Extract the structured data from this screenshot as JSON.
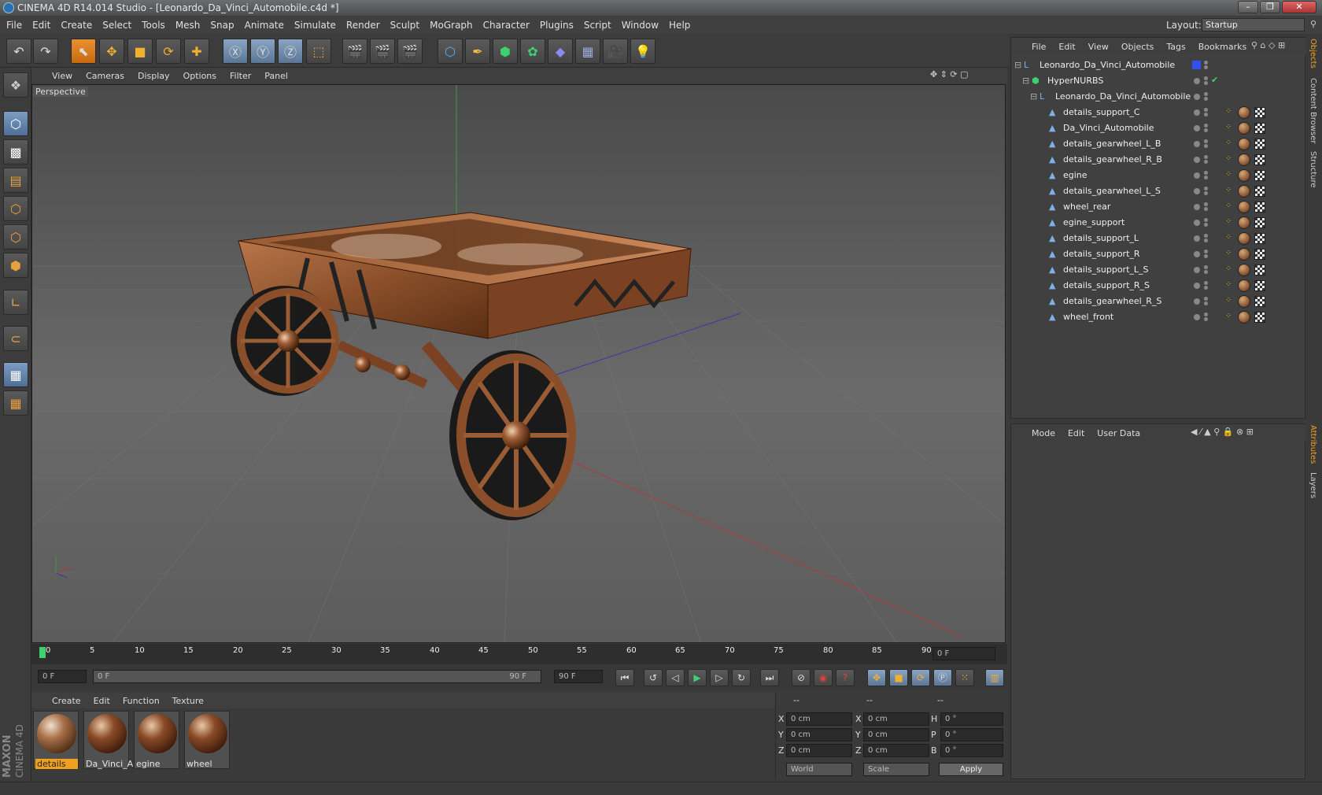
{
  "window": {
    "title": "CINEMA 4D R14.014 Studio - [Leonardo_Da_Vinci_Automobile.c4d *]"
  },
  "menu": [
    "File",
    "Edit",
    "Create",
    "Select",
    "Tools",
    "Mesh",
    "Snap",
    "Animate",
    "Simulate",
    "Render",
    "Sculpt",
    "MoGraph",
    "Character",
    "Plugins",
    "Script",
    "Window",
    "Help"
  ],
  "layout": {
    "label": "Layout:",
    "value": "Startup"
  },
  "viewport": {
    "menu": [
      "View",
      "Cameras",
      "Display",
      "Options",
      "Filter",
      "Panel"
    ],
    "label": "Perspective"
  },
  "timeline": {
    "ticks": [
      "0",
      "5",
      "10",
      "15",
      "20",
      "25",
      "30",
      "35",
      "40",
      "45",
      "50",
      "55",
      "60",
      "65",
      "70",
      "75",
      "80",
      "85",
      "90"
    ],
    "current_frame": "0 F"
  },
  "transport": {
    "start": "0 F",
    "slider_start": "0 F",
    "slider_end": "90 F",
    "end": "90 F"
  },
  "objects": {
    "menu": [
      "File",
      "Edit",
      "View",
      "Objects",
      "Tags",
      "Bookmarks"
    ],
    "root": "Leonardo_Da_Vinci_Automobile",
    "nurbs": "HyperNURBS",
    "group": "Leonardo_Da_Vinci_Automobile",
    "items": [
      "details_support_C",
      "Da_Vinci_Automobile",
      "details_gearwheel_L_B",
      "details_gearwheel_R_B",
      "egine",
      "details_gearwheel_L_S",
      "wheel_rear",
      "egine_support",
      "details_support_L",
      "details_support_R",
      "details_support_L_S",
      "details_support_R_S",
      "details_gearwheel_R_S",
      "wheel_front"
    ]
  },
  "attributes": {
    "menu": [
      "Mode",
      "Edit",
      "User Data"
    ]
  },
  "sidetabs": {
    "top": [
      "Objects",
      "Content Browser",
      "Structure"
    ],
    "bottom": [
      "Attributes",
      "Layers"
    ]
  },
  "materials": {
    "menu": [
      "Create",
      "Edit",
      "Function",
      "Texture"
    ],
    "items": [
      "details",
      "Da_Vinci_A",
      "egine",
      "wheel"
    ]
  },
  "coords": {
    "header": [
      "--",
      "--",
      "--"
    ],
    "rows": [
      {
        "a": "X",
        "av": "0 cm",
        "b": "X",
        "bv": "0 cm",
        "c": "H",
        "cv": "0 °"
      },
      {
        "a": "Y",
        "av": "0 cm",
        "b": "Y",
        "bv": "0 cm",
        "c": "P",
        "cv": "0 °"
      },
      {
        "a": "Z",
        "av": "0 cm",
        "b": "Z",
        "bv": "0 cm",
        "c": "B",
        "cv": "0 °"
      }
    ],
    "world": "World",
    "scale": "Scale",
    "apply": "Apply"
  },
  "brand": {
    "maxon": "MAXON",
    "product": "CINEMA 4D"
  }
}
